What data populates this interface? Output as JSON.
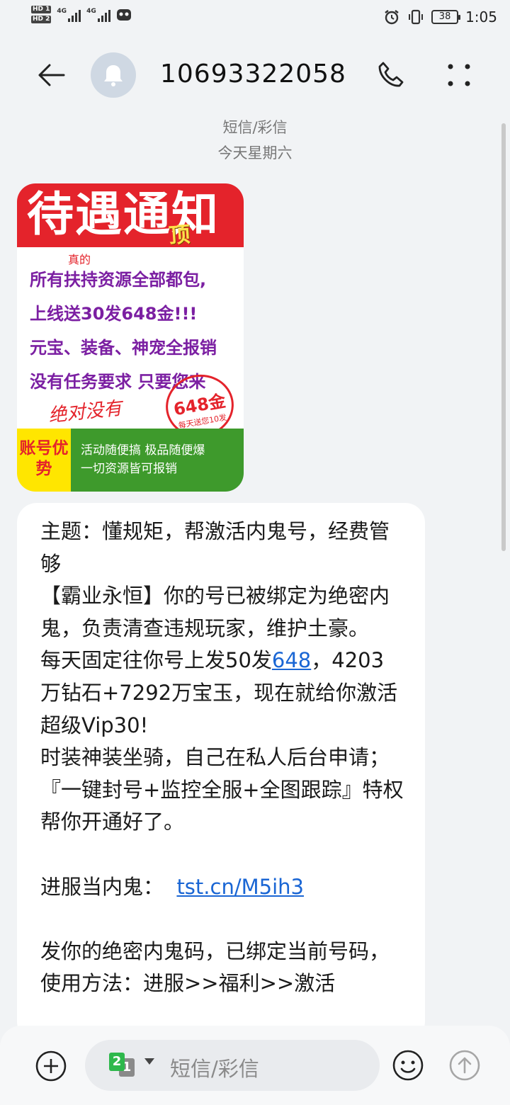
{
  "status": {
    "hd1": "HD 1",
    "hd2": "HD 2",
    "net1": "4G",
    "net2": "4G",
    "battery": "38",
    "time": "1:05"
  },
  "header": {
    "contact": "10693322058"
  },
  "subtitle": {
    "type": "短信/彩信",
    "date": "今天星期六"
  },
  "mms_image": {
    "title": "待遇通知",
    "tag": "顶",
    "note": "真的",
    "line1": "所有扶持资源全部都包,",
    "line2": "上线送30发648金!!!",
    "line3": "元宝、装备、神宠全报销",
    "line4": "没有任务要求 只要您来",
    "scrawl": "绝对没有",
    "stamp_big": "648金",
    "stamp_small": "每天送您10发",
    "badge": "账号优势",
    "green1": "活动随便搞  极品随便爆",
    "green2": "一切资源皆可报销"
  },
  "message": {
    "p1": "主题：懂规矩，帮激活内鬼号，经费管够\n【霸业永恒】你的号已被绑定为绝密内鬼，负责清查违规玩家，维护土豪。\n每天固定往你号上发50发",
    "link_648": "648",
    "p2": "，4203万钻石+7292万宝玉，现在就给你激活超级Vip30!\n时装神装坐骑，自己在私人后台申请；『一键封号+监控全服+全图跟踪』特权帮你开通好了。\n\n进服当内鬼：  ",
    "link_url": "tst.cn/M5ih3",
    "p3": "\n\n发你的绝密内鬼码，已绑定当前号码，使用方法：进服>>福利>>激活"
  },
  "input": {
    "sim_primary": "2",
    "sim_secondary": "1",
    "placeholder": "短信/彩信"
  }
}
